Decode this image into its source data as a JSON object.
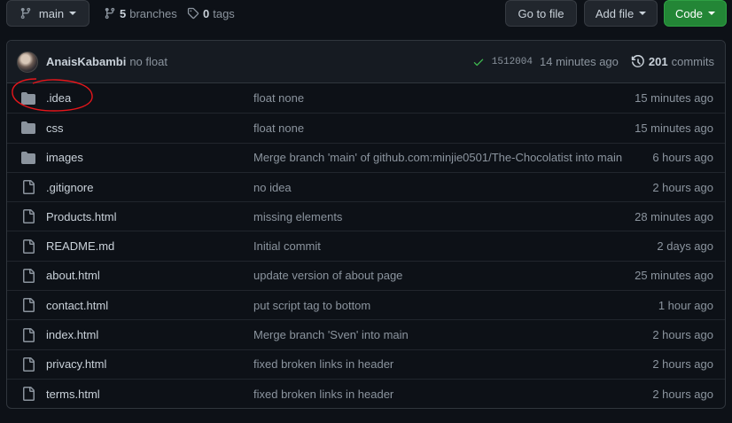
{
  "toolbar": {
    "branch": "main",
    "branches_count": "5",
    "branches_label": "branches",
    "tags_count": "0",
    "tags_label": "tags",
    "go_to_file": "Go to file",
    "add_file": "Add file",
    "code": "Code"
  },
  "latest_commit": {
    "author": "AnaisKabambi",
    "message": "no float",
    "sha": "1512004",
    "time": "14 minutes ago",
    "commits_count": "201",
    "commits_label": "commits"
  },
  "files": [
    {
      "type": "folder",
      "name": ".idea",
      "message": "float none",
      "age": "15 minutes ago"
    },
    {
      "type": "folder",
      "name": "css",
      "message": "float none",
      "age": "15 minutes ago"
    },
    {
      "type": "folder",
      "name": "images",
      "message": "Merge branch 'main' of github.com:minjie0501/The-Chocolatist into main",
      "age": "6 hours ago"
    },
    {
      "type": "file",
      "name": ".gitignore",
      "message": "no idea",
      "age": "2 hours ago"
    },
    {
      "type": "file",
      "name": "Products.html",
      "message": "missing elements",
      "age": "28 minutes ago"
    },
    {
      "type": "file",
      "name": "README.md",
      "message": "Initial commit",
      "age": "2 days ago"
    },
    {
      "type": "file",
      "name": "about.html",
      "message": "update version of about page",
      "age": "25 minutes ago"
    },
    {
      "type": "file",
      "name": "contact.html",
      "message": "put script tag to bottom",
      "age": "1 hour ago"
    },
    {
      "type": "file",
      "name": "index.html",
      "message": "Merge branch 'Sven' into main",
      "age": "2 hours ago"
    },
    {
      "type": "file",
      "name": "privacy.html",
      "message": "fixed broken links in header",
      "age": "2 hours ago"
    },
    {
      "type": "file",
      "name": "terms.html",
      "message": "fixed broken links in header",
      "age": "2 hours ago"
    }
  ],
  "colors": {
    "background": "#0d1117",
    "accent_green": "#238636",
    "check_green": "#3fb950",
    "annotation_red": "#e5161b"
  },
  "icons": {
    "branch": "git-branch-icon",
    "tag": "tag-icon",
    "history": "history-icon",
    "check": "check-icon",
    "folder": "folder-icon",
    "file": "file-icon"
  }
}
